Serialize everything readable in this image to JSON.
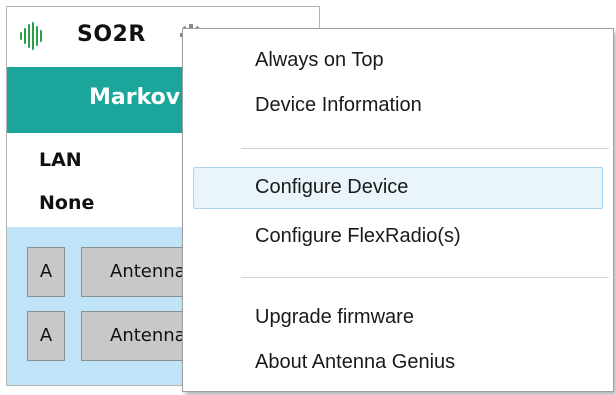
{
  "app": {
    "title": "SO2R",
    "banner_text": "Markov"
  },
  "info": {
    "line1": "LAN",
    "line2": "None"
  },
  "antenna_rows": [
    {
      "letter": "A",
      "name": "Antenna"
    },
    {
      "letter": "A",
      "name": "Antenna"
    }
  ],
  "icons": {
    "app_icon": "waveform-icon",
    "settings": "gear-icon",
    "close": "close-icon"
  },
  "colors": {
    "banner": "#1ca59a",
    "antenna_panel": "#bfe3f7",
    "menu_highlight": "#eaf4fb"
  },
  "context_menu": {
    "items": [
      {
        "label": "Always on Top"
      },
      {
        "label": "Device Information"
      },
      {
        "label": "Configure Device",
        "highlighted": true
      },
      {
        "label": "Configure FlexRadio(s)"
      },
      {
        "label": "Upgrade firmware"
      },
      {
        "label": "About Antenna Genius"
      }
    ]
  }
}
